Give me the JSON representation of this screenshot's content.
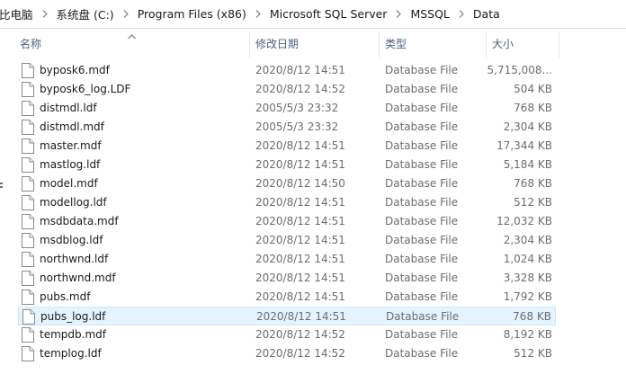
{
  "breadcrumb": [
    "比电脑",
    "系统盘 (C:)",
    "Program Files (x86)",
    "Microsoft SQL Server",
    "MSSQL",
    "Data"
  ],
  "columns": {
    "name": "名称",
    "date": "修改日期",
    "type": "类型",
    "size": "大小"
  },
  "icons": {
    "file": "file-icon",
    "separator": "chevron-right-icon",
    "sort": "sort-up-chevron-icon"
  },
  "files": [
    {
      "name": "byposk6.mdf",
      "date": "2020/8/12 14:51",
      "type": "Database File",
      "size": "5,715,008..."
    },
    {
      "name": "byposk6_log.LDF",
      "date": "2020/8/12 14:52",
      "type": "Database File",
      "size": "504 KB"
    },
    {
      "name": "distmdl.ldf",
      "date": "2005/5/3 23:32",
      "type": "Database File",
      "size": "768 KB"
    },
    {
      "name": "distmdl.mdf",
      "date": "2005/5/3 23:32",
      "type": "Database File",
      "size": "2,304 KB"
    },
    {
      "name": "master.mdf",
      "date": "2020/8/12 14:51",
      "type": "Database File",
      "size": "17,344 KB"
    },
    {
      "name": "mastlog.ldf",
      "date": "2020/8/12 14:51",
      "type": "Database File",
      "size": "5,184 KB"
    },
    {
      "name": "model.mdf",
      "date": "2020/8/12 14:50",
      "type": "Database File",
      "size": "768 KB"
    },
    {
      "name": "modellog.ldf",
      "date": "2020/8/12 14:51",
      "type": "Database File",
      "size": "512 KB"
    },
    {
      "name": "msdbdata.mdf",
      "date": "2020/8/12 14:51",
      "type": "Database File",
      "size": "12,032 KB"
    },
    {
      "name": "msdblog.ldf",
      "date": "2020/8/12 14:51",
      "type": "Database File",
      "size": "2,304 KB"
    },
    {
      "name": "northwnd.ldf",
      "date": "2020/8/12 14:51",
      "type": "Database File",
      "size": "1,024 KB"
    },
    {
      "name": "northwnd.mdf",
      "date": "2020/8/12 14:51",
      "type": "Database File",
      "size": "3,328 KB"
    },
    {
      "name": "pubs.mdf",
      "date": "2020/8/12 14:51",
      "type": "Database File",
      "size": "1,792 KB"
    },
    {
      "name": "pubs_log.ldf",
      "date": "2020/8/12 14:51",
      "type": "Database File",
      "size": "768 KB",
      "hovered": true
    },
    {
      "name": "tempdb.mdf",
      "date": "2020/8/12 14:52",
      "type": "Database File",
      "size": "8,192 KB"
    },
    {
      "name": "templog.ldf",
      "date": "2020/8/12 14:52",
      "type": "Database File",
      "size": "512 KB"
    }
  ]
}
